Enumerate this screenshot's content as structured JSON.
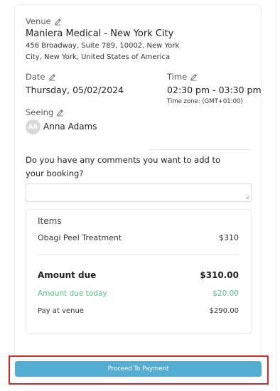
{
  "venue": {
    "label": "Venue",
    "name": "Maniera Medical - New York City",
    "address": "456 Broadway, Suite 789, 10002, New York City, New York, United States of America"
  },
  "date": {
    "label": "Date",
    "value": "Thursday, 05/02/2024"
  },
  "time": {
    "label": "Time",
    "value": "02:30 pm - 03:30 pm",
    "timezone": "Time zone: (GMT+01:00)"
  },
  "seeing": {
    "label": "Seeing",
    "initials": "AA",
    "name": "Anna Adams"
  },
  "comments": {
    "question": "Do you have any comments you want to add to your booking?",
    "value": ""
  },
  "items": {
    "title": "Items",
    "list": [
      {
        "name": "Obagi Peel Treatment",
        "price": "$310"
      }
    ]
  },
  "summary": {
    "amount_due_label": "Amount due",
    "amount_due_value": "$310.00",
    "due_today_label": "Amount due today",
    "due_today_value": "$20.00",
    "pay_at_venue_label": "Pay at venue",
    "pay_at_venue_value": "$290.00"
  },
  "proceed_button": {
    "label": "Proceed To Payment"
  },
  "colors": {
    "accent_button": "#54aed3",
    "due_today_green": "#52c08d",
    "highlight_red": "#d62b2b"
  },
  "icons": {
    "edit": "pencil-icon",
    "resize": "resize-grip-icon"
  }
}
